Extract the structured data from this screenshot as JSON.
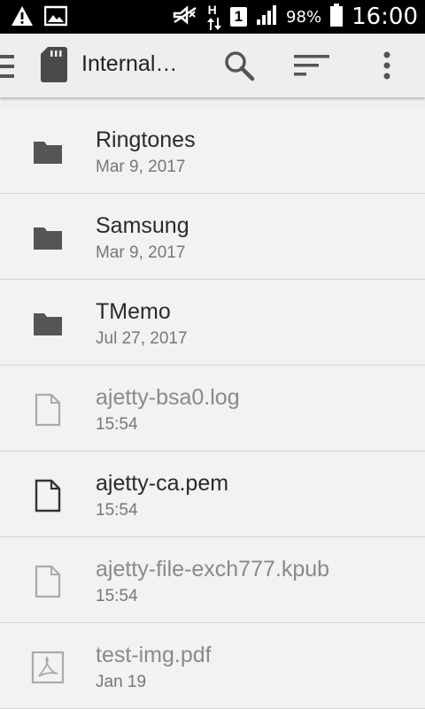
{
  "status_bar": {
    "battery_percent": "98%",
    "sim_slot": "1",
    "network_type": "H",
    "time": "16:00",
    "icons": [
      "warning-icon",
      "image-icon",
      "mute-icon",
      "data-arrows-icon",
      "signal-icon",
      "battery-icon"
    ]
  },
  "toolbar": {
    "title": "Internal…",
    "icons": [
      "menu-icon",
      "sd-card-icon",
      "search-icon",
      "sort-icon",
      "more-icon"
    ]
  },
  "files": [
    {
      "name": "Ringtones",
      "meta": "Mar 9, 2017",
      "type": "folder",
      "enabled": true
    },
    {
      "name": "Samsung",
      "meta": "Mar 9, 2017",
      "type": "folder",
      "enabled": true
    },
    {
      "name": "TMemo",
      "meta": "Jul 27, 2017",
      "type": "folder",
      "enabled": true
    },
    {
      "name": "ajetty-bsa0.log",
      "meta": "15:54",
      "type": "file",
      "enabled": false
    },
    {
      "name": "ajetty-ca.pem",
      "meta": "15:54",
      "type": "file",
      "enabled": true
    },
    {
      "name": "ajetty-file-exch777.kpub",
      "meta": "15:54",
      "type": "file",
      "enabled": false
    },
    {
      "name": "test-img.pdf",
      "meta": "Jan 19",
      "type": "pdf",
      "enabled": false
    }
  ]
}
